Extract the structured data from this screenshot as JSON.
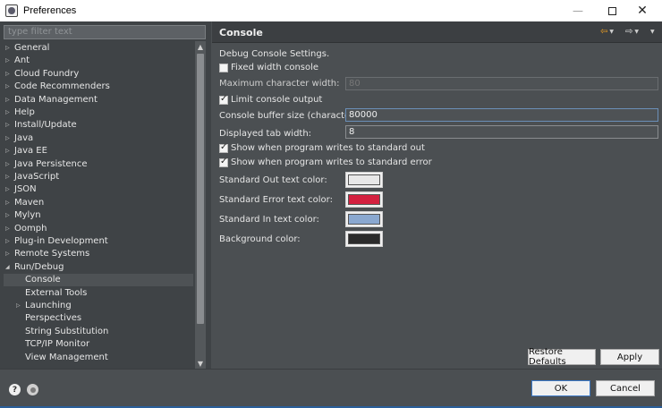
{
  "window": {
    "title": "Preferences"
  },
  "filter": {
    "placeholder": "type filter text"
  },
  "tree": [
    {
      "label": "General",
      "expandable": true,
      "level": 0
    },
    {
      "label": "Ant",
      "expandable": true,
      "level": 0
    },
    {
      "label": "Cloud Foundry",
      "expandable": true,
      "level": 0
    },
    {
      "label": "Code Recommenders",
      "expandable": true,
      "level": 0
    },
    {
      "label": "Data Management",
      "expandable": true,
      "level": 0
    },
    {
      "label": "Help",
      "expandable": true,
      "level": 0
    },
    {
      "label": "Install/Update",
      "expandable": true,
      "level": 0
    },
    {
      "label": "Java",
      "expandable": true,
      "level": 0
    },
    {
      "label": "Java EE",
      "expandable": true,
      "level": 0
    },
    {
      "label": "Java Persistence",
      "expandable": true,
      "level": 0
    },
    {
      "label": "JavaScript",
      "expandable": true,
      "level": 0
    },
    {
      "label": "JSON",
      "expandable": true,
      "level": 0
    },
    {
      "label": "Maven",
      "expandable": true,
      "level": 0
    },
    {
      "label": "Mylyn",
      "expandable": true,
      "level": 0
    },
    {
      "label": "Oomph",
      "expandable": true,
      "level": 0
    },
    {
      "label": "Plug-in Development",
      "expandable": true,
      "level": 0
    },
    {
      "label": "Remote Systems",
      "expandable": true,
      "level": 0
    },
    {
      "label": "Run/Debug",
      "expandable": true,
      "expanded": true,
      "level": 0
    },
    {
      "label": "Console",
      "expandable": false,
      "level": 1,
      "selected": true
    },
    {
      "label": "External Tools",
      "expandable": false,
      "level": 1
    },
    {
      "label": "Launching",
      "expandable": true,
      "level": 1
    },
    {
      "label": "Perspectives",
      "expandable": false,
      "level": 1
    },
    {
      "label": "String Substitution",
      "expandable": false,
      "level": 1
    },
    {
      "label": "TCP/IP Monitor",
      "expandable": false,
      "level": 1
    },
    {
      "label": "View Management",
      "expandable": false,
      "level": 1
    }
  ],
  "page": {
    "title": "Console",
    "description": "Debug Console Settings.",
    "fixed_width_label": "Fixed width console",
    "fixed_width_checked": false,
    "max_char_width_label": "Maximum character width:",
    "max_char_width_value": "80",
    "limit_output_label": "Limit console output",
    "limit_output_checked": true,
    "buffer_size_label": "Console buffer size (characters):",
    "buffer_size_value": "80000",
    "tab_width_label": "Displayed tab width:",
    "tab_width_value": "8",
    "show_stdout_label": "Show when program writes to standard out",
    "show_stdout_checked": true,
    "show_stderr_label": "Show when program writes to standard error",
    "show_stderr_checked": true,
    "colors": [
      {
        "label": "Standard Out text color:",
        "color": "#e8e8e8"
      },
      {
        "label": "Standard Error text color:",
        "color": "#d3203f"
      },
      {
        "label": "Standard In text color:",
        "color": "#8aa8d0"
      },
      {
        "label": "Background color:",
        "color": "#2b2b2b"
      }
    ],
    "restore_defaults_label": "Restore Defaults",
    "apply_label": "Apply"
  },
  "footer": {
    "ok_label": "OK",
    "cancel_label": "Cancel"
  },
  "icons": {
    "nav_back": "arrow-left-icon",
    "nav_forward": "arrow-right-icon",
    "help": "help-icon",
    "import": "import-export-icon"
  },
  "colors": {
    "accent": "#3b78c6",
    "nav_back": "#f0a020"
  }
}
